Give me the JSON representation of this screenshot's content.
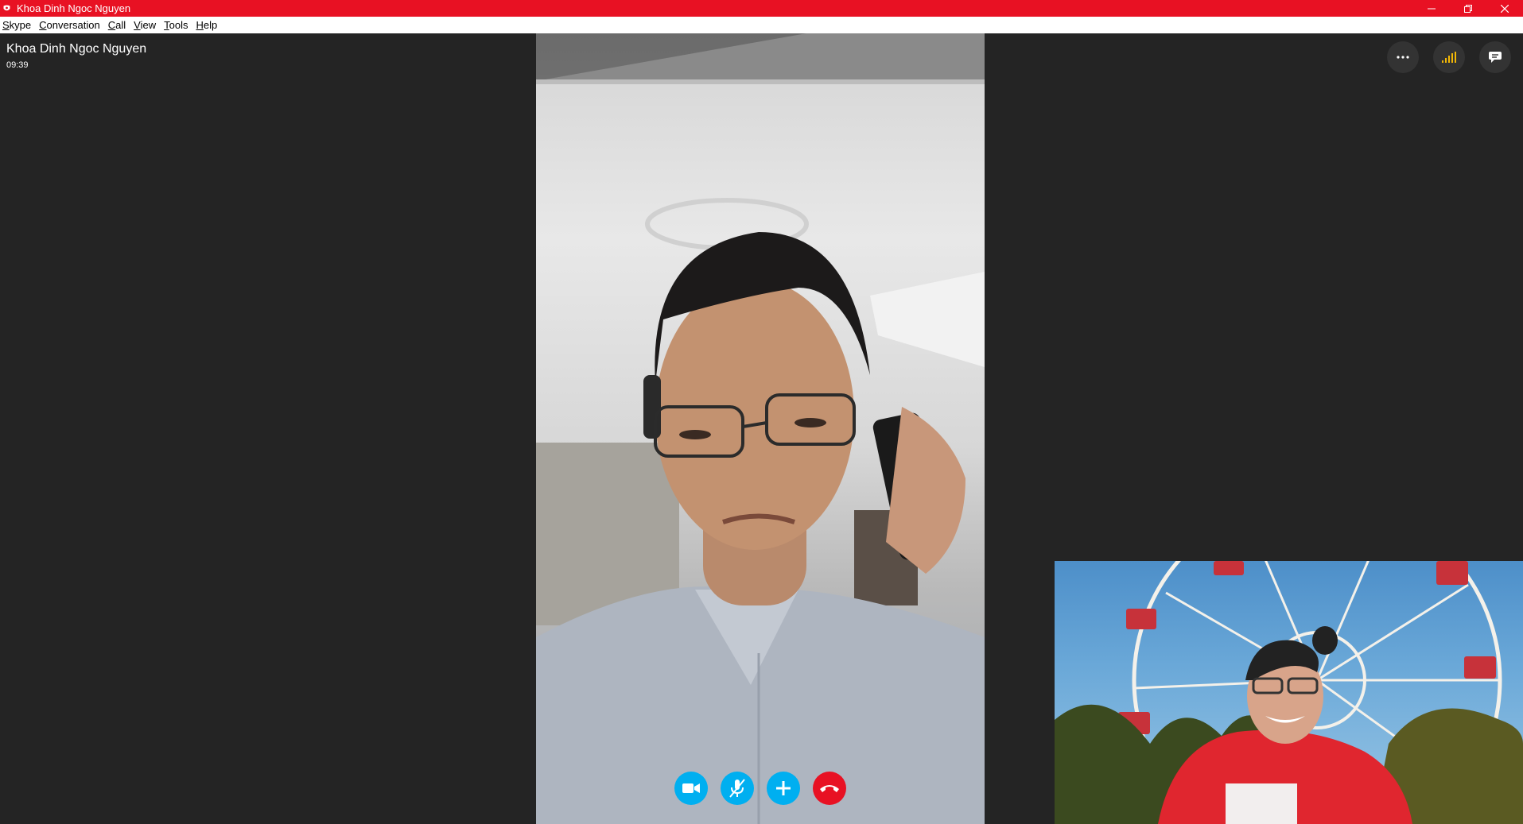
{
  "window": {
    "title": "Khoa Dinh Ngoc Nguyen",
    "title_bar_color": "#e81123"
  },
  "menu": {
    "items": [
      {
        "label": "Skype",
        "underline": "S",
        "rest": "kype"
      },
      {
        "label": "Conversation",
        "underline": "C",
        "rest": "onversation"
      },
      {
        "label": "Call",
        "underline": "C",
        "rest": "all"
      },
      {
        "label": "View",
        "underline": "V",
        "rest": "iew"
      },
      {
        "label": "Tools",
        "underline": "T",
        "rest": "ools"
      },
      {
        "label": "Help",
        "underline": "H",
        "rest": "elp"
      }
    ]
  },
  "call": {
    "contact_name": "Khoa Dinh Ngoc Nguyen",
    "duration": "09:39"
  },
  "controls": {
    "top": [
      {
        "icon": "more-options-icon"
      },
      {
        "icon": "call-quality-icon"
      },
      {
        "icon": "chat-icon"
      }
    ],
    "bottom": [
      {
        "icon": "video-camera-icon",
        "color": "#00aff0"
      },
      {
        "icon": "microphone-muted-icon",
        "color": "#00aff0"
      },
      {
        "icon": "add-participant-icon",
        "color": "#00aff0"
      },
      {
        "icon": "end-call-icon",
        "color": "#e81123"
      }
    ]
  },
  "colors": {
    "stage_background": "#242424",
    "skype_blue": "#00aff0",
    "hangup_red": "#e81123",
    "signal_yellow": "#f2b705"
  }
}
